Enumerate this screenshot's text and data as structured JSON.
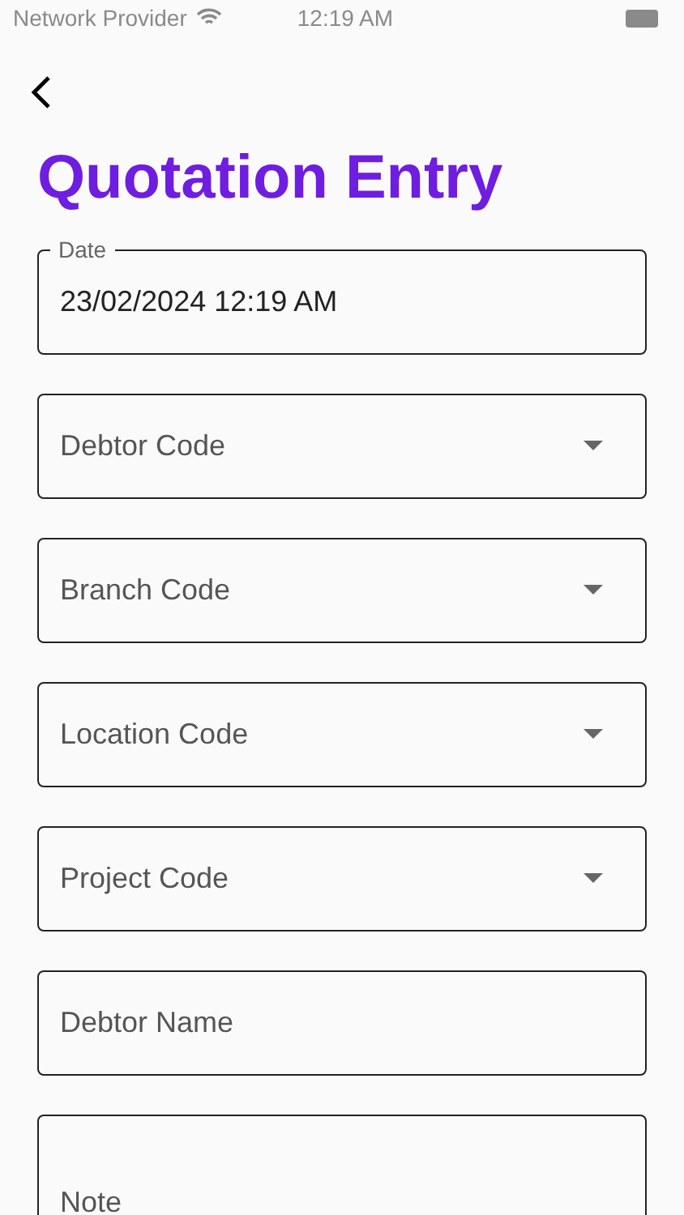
{
  "status_bar": {
    "carrier": "Network Provider",
    "time": "12:19 AM"
  },
  "title": "Quotation Entry",
  "fields": [
    {
      "kind": "date",
      "label": "Date",
      "value": "23/02/2024 12:19 AM"
    },
    {
      "kind": "dropdown",
      "placeholder": "Debtor Code"
    },
    {
      "kind": "dropdown",
      "placeholder": "Branch Code"
    },
    {
      "kind": "dropdown",
      "placeholder": "Location Code"
    },
    {
      "kind": "dropdown",
      "placeholder": "Project Code"
    },
    {
      "kind": "text",
      "placeholder": "Debtor Name"
    },
    {
      "kind": "multiline",
      "placeholder": "Note"
    }
  ]
}
